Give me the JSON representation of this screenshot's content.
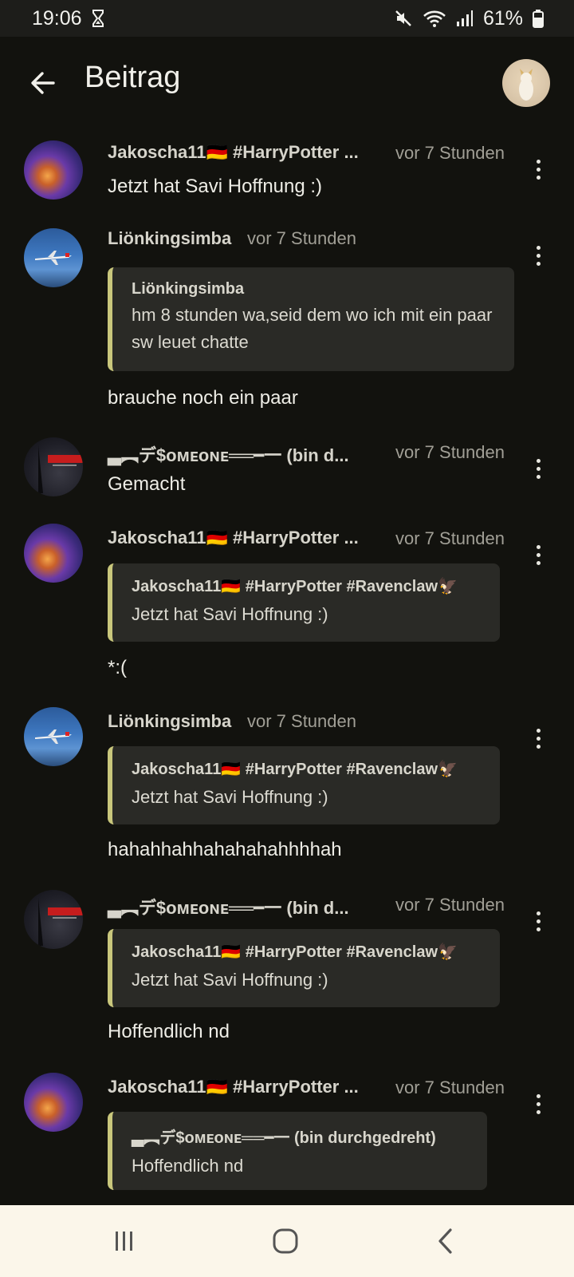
{
  "status": {
    "time": "19:06",
    "battery": "61%"
  },
  "app_bar": {
    "title": "Beitrag"
  },
  "comments": [
    {
      "author": "Jakoscha11🇩🇪 #HarryPotter ...",
      "time": "vor 7 Stunden",
      "text": "Jetzt hat Savi Hoffnung :)"
    },
    {
      "author": "Liönkingsimba",
      "time": "vor 7 Stunden",
      "quote": {
        "author": "Liönkingsimba",
        "text": "hm 8 stunden wa,seid dem wo ich mit ein paar sw leuet chatte"
      },
      "text": "brauche noch ein paar"
    },
    {
      "author": "▃︻デ$ᴏᴍᴇᴏɴᴇ══━一 (bin d...",
      "time": "vor 7 Stunden",
      "text": "Gemacht"
    },
    {
      "author": "Jakoscha11🇩🇪 #HarryPotter ...",
      "time": "vor 7 Stunden",
      "quote": {
        "author": "Jakoscha11🇩🇪 #HarryPotter #Ravenclaw🦅",
        "text": "Jetzt hat Savi Hoffnung :)"
      },
      "text": "*:("
    },
    {
      "author": "Liönkingsimba",
      "time": "vor 7 Stunden",
      "quote": {
        "author": "Jakoscha11🇩🇪 #HarryPotter #Ravenclaw🦅",
        "text": "Jetzt hat Savi Hoffnung :)"
      },
      "text": "hahahhahhahahahahhhhah"
    },
    {
      "author": "▃︻デ$ᴏᴍᴇᴏɴᴇ══━一 (bin d...",
      "time": "vor 7 Stunden",
      "quote": {
        "author": "Jakoscha11🇩🇪 #HarryPotter #Ravenclaw🦅",
        "text": "Jetzt hat Savi Hoffnung :)"
      },
      "text": "Hoffendlich nd"
    },
    {
      "author": "Jakoscha11🇩🇪 #HarryPotter ...",
      "time": "vor 7 Stunden",
      "quote": {
        "author": "▃︻デ$ᴏᴍᴇᴏɴᴇ══━一 (bin durchgedreht)",
        "text": "Hoffendlich nd"
      }
    }
  ],
  "icons": {
    "hourglass": "hourglass-icon",
    "mute": "mute-icon",
    "wifi": "wifi-icon",
    "signal": "signal-icon",
    "battery": "battery-icon",
    "back": "back-arrow-icon",
    "more": "more-vert-icon",
    "recents": "recents-icon",
    "home": "home-icon",
    "nav_back": "nav-back-icon"
  },
  "colors": {
    "background": "#12120e",
    "quote_bar": "#c9c77c",
    "nav_bar": "#fbf6ea"
  }
}
